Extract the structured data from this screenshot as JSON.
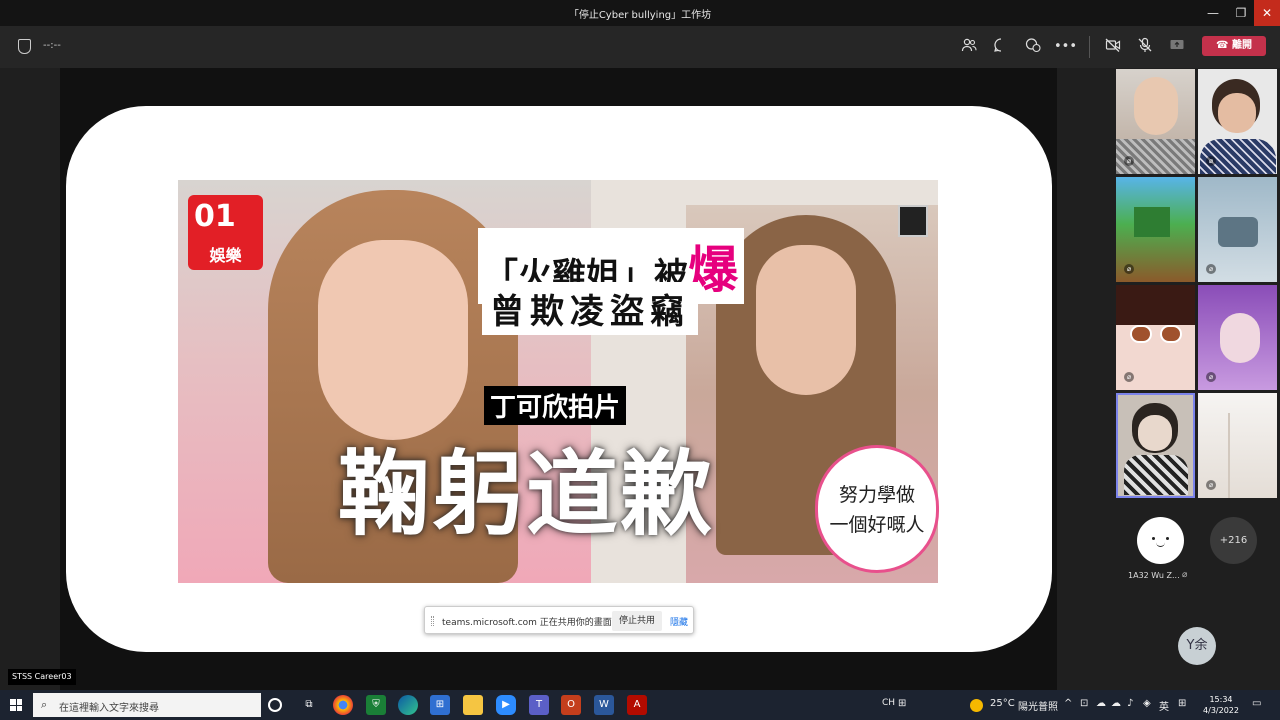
{
  "window": {
    "title": "「停止Cyber bullying」工作坊",
    "min_glyph": "—",
    "max_glyph": "❐",
    "close_glyph": "✕"
  },
  "meeting": {
    "timer": "--:--",
    "leave_label": "離開",
    "more_glyph": "•••"
  },
  "slide": {
    "logo_mark": "01",
    "logo_label": "娛樂",
    "headline_1": "「火雞姐」被",
    "headline_1_emph": "爆",
    "headline_2": "曾欺凌盜竊",
    "caption": "丁可欣拍片",
    "big_text": "鞠躬道歉",
    "bubble_line1": "努力學做",
    "bubble_line2": "一個好嘅人"
  },
  "share_bar": {
    "message": "teams.microsoft.com 正在共用你的畫面。",
    "stop_label": "停止共用",
    "hide_label": "隱藏"
  },
  "presenter_label": "STSS Career03",
  "participants": {
    "avatar_name": "1A32 Wu Z...",
    "more_count": "+216",
    "self_initials": "Y余"
  },
  "taskbar": {
    "search_placeholder": "在這裡輸入文字來搜尋",
    "weather_temp": "25°C",
    "weather_text": "陽光普照",
    "ime_1": "CH",
    "ime_lang": "英",
    "time": "15:34",
    "date": "4/3/2022"
  },
  "colors": {
    "leave": "#c4314b",
    "accent_pink": "#e6007e",
    "logo_red": "#e21f26",
    "active_tile": "#7b83eb"
  }
}
